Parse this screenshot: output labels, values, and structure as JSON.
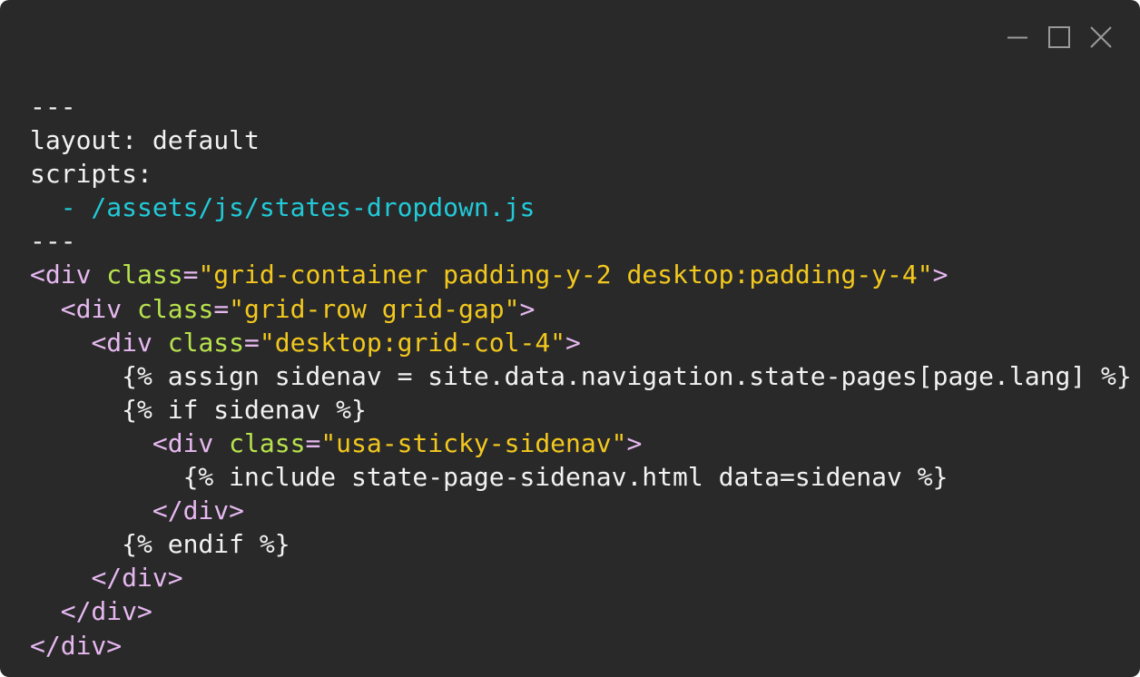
{
  "window": {
    "background": "#292929",
    "controls": [
      {
        "name": "minimize",
        "icon": "minimize-icon"
      },
      {
        "name": "maximize",
        "icon": "maximize-icon"
      },
      {
        "name": "close",
        "icon": "close-icon"
      }
    ]
  },
  "colors": {
    "text": "#f2f2f2",
    "tag": "#e6b8f0",
    "attribute": "#b8e34d",
    "string": "#f2c81e",
    "list_item": "#22cad8"
  },
  "code": {
    "lines": [
      [
        {
          "t": "---",
          "c": "plain"
        }
      ],
      [
        {
          "t": "layout: default",
          "c": "plain"
        }
      ],
      [
        {
          "t": "scripts:",
          "c": "plain"
        }
      ],
      [
        {
          "t": "  - /assets/js/states-dropdown.js",
          "c": "list"
        }
      ],
      [
        {
          "t": "---",
          "c": "plain"
        }
      ],
      [
        {
          "t": "<div",
          "c": "tag"
        },
        {
          "t": " ",
          "c": "plain"
        },
        {
          "t": "class",
          "c": "attr"
        },
        {
          "t": "=",
          "c": "tag"
        },
        {
          "t": "\"grid-container padding-y-2 desktop:padding-y-4\"",
          "c": "str"
        },
        {
          "t": ">",
          "c": "tag"
        }
      ],
      [
        {
          "t": "  ",
          "c": "plain"
        },
        {
          "t": "<div",
          "c": "tag"
        },
        {
          "t": " ",
          "c": "plain"
        },
        {
          "t": "class",
          "c": "attr"
        },
        {
          "t": "=",
          "c": "tag"
        },
        {
          "t": "\"grid-row grid-gap\"",
          "c": "str"
        },
        {
          "t": ">",
          "c": "tag"
        }
      ],
      [
        {
          "t": "    ",
          "c": "plain"
        },
        {
          "t": "<div",
          "c": "tag"
        },
        {
          "t": " ",
          "c": "plain"
        },
        {
          "t": "class",
          "c": "attr"
        },
        {
          "t": "=",
          "c": "tag"
        },
        {
          "t": "\"desktop:grid-col-4\"",
          "c": "str"
        },
        {
          "t": ">",
          "c": "tag"
        }
      ],
      [
        {
          "t": "      {% assign sidenav = site.data.navigation.state-pages[page.lang] %}",
          "c": "plain"
        }
      ],
      [
        {
          "t": "      {% if sidenav %}",
          "c": "plain"
        }
      ],
      [
        {
          "t": "        ",
          "c": "plain"
        },
        {
          "t": "<div",
          "c": "tag"
        },
        {
          "t": " ",
          "c": "plain"
        },
        {
          "t": "class",
          "c": "attr"
        },
        {
          "t": "=",
          "c": "tag"
        },
        {
          "t": "\"usa-sticky-sidenav\"",
          "c": "str"
        },
        {
          "t": ">",
          "c": "tag"
        }
      ],
      [
        {
          "t": "          {% include state-page-sidenav.html data=sidenav %}",
          "c": "plain"
        }
      ],
      [
        {
          "t": "        ",
          "c": "plain"
        },
        {
          "t": "</div>",
          "c": "tag"
        }
      ],
      [
        {
          "t": "      {% endif %}",
          "c": "plain"
        }
      ],
      [
        {
          "t": "    ",
          "c": "plain"
        },
        {
          "t": "</div>",
          "c": "tag"
        }
      ],
      [
        {
          "t": "  ",
          "c": "plain"
        },
        {
          "t": "</div>",
          "c": "tag"
        }
      ],
      [
        {
          "t": "</div>",
          "c": "tag"
        }
      ]
    ]
  }
}
